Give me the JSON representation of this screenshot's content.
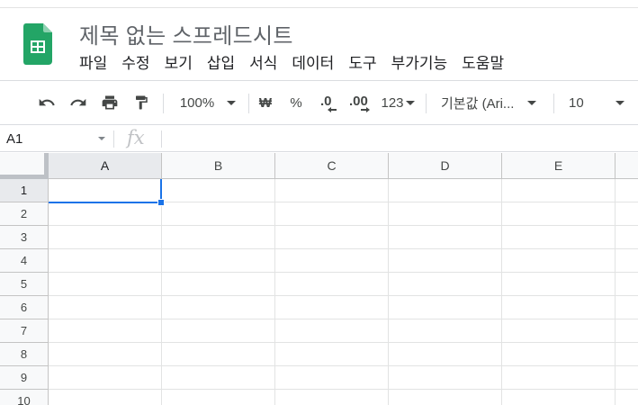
{
  "document": {
    "title": "제목 없는 스프레드시트"
  },
  "menu": [
    "파일",
    "수정",
    "보기",
    "삽입",
    "서식",
    "데이터",
    "도구",
    "부가기능",
    "도움말"
  ],
  "toolbar": {
    "undo_icon": "undo-icon",
    "redo_icon": "redo-icon",
    "print_icon": "print-icon",
    "paint_format_icon": "paint-format-icon",
    "zoom": "100%",
    "currency": "₩",
    "percent": "%",
    "decrease_decimal": ".0",
    "increase_decimal": ".00",
    "number_format": "123",
    "font_family": "기본값 (Ari...",
    "font_size": "10"
  },
  "formula_bar": {
    "cell_reference": "A1",
    "fx_label": "fx",
    "formula_value": ""
  },
  "sheet": {
    "columns": [
      "A",
      "B",
      "C",
      "D",
      "E"
    ],
    "rows": [
      "1",
      "2",
      "3",
      "4",
      "5",
      "6",
      "7",
      "8",
      "9",
      "10"
    ],
    "active_cell": "A1"
  },
  "colors": {
    "accent": "#1a73e8",
    "logo_green": "#23a566",
    "header_bg": "#f8f9fa",
    "header_selected_bg": "#e8eaed",
    "gridline": "#e2e3e3"
  }
}
